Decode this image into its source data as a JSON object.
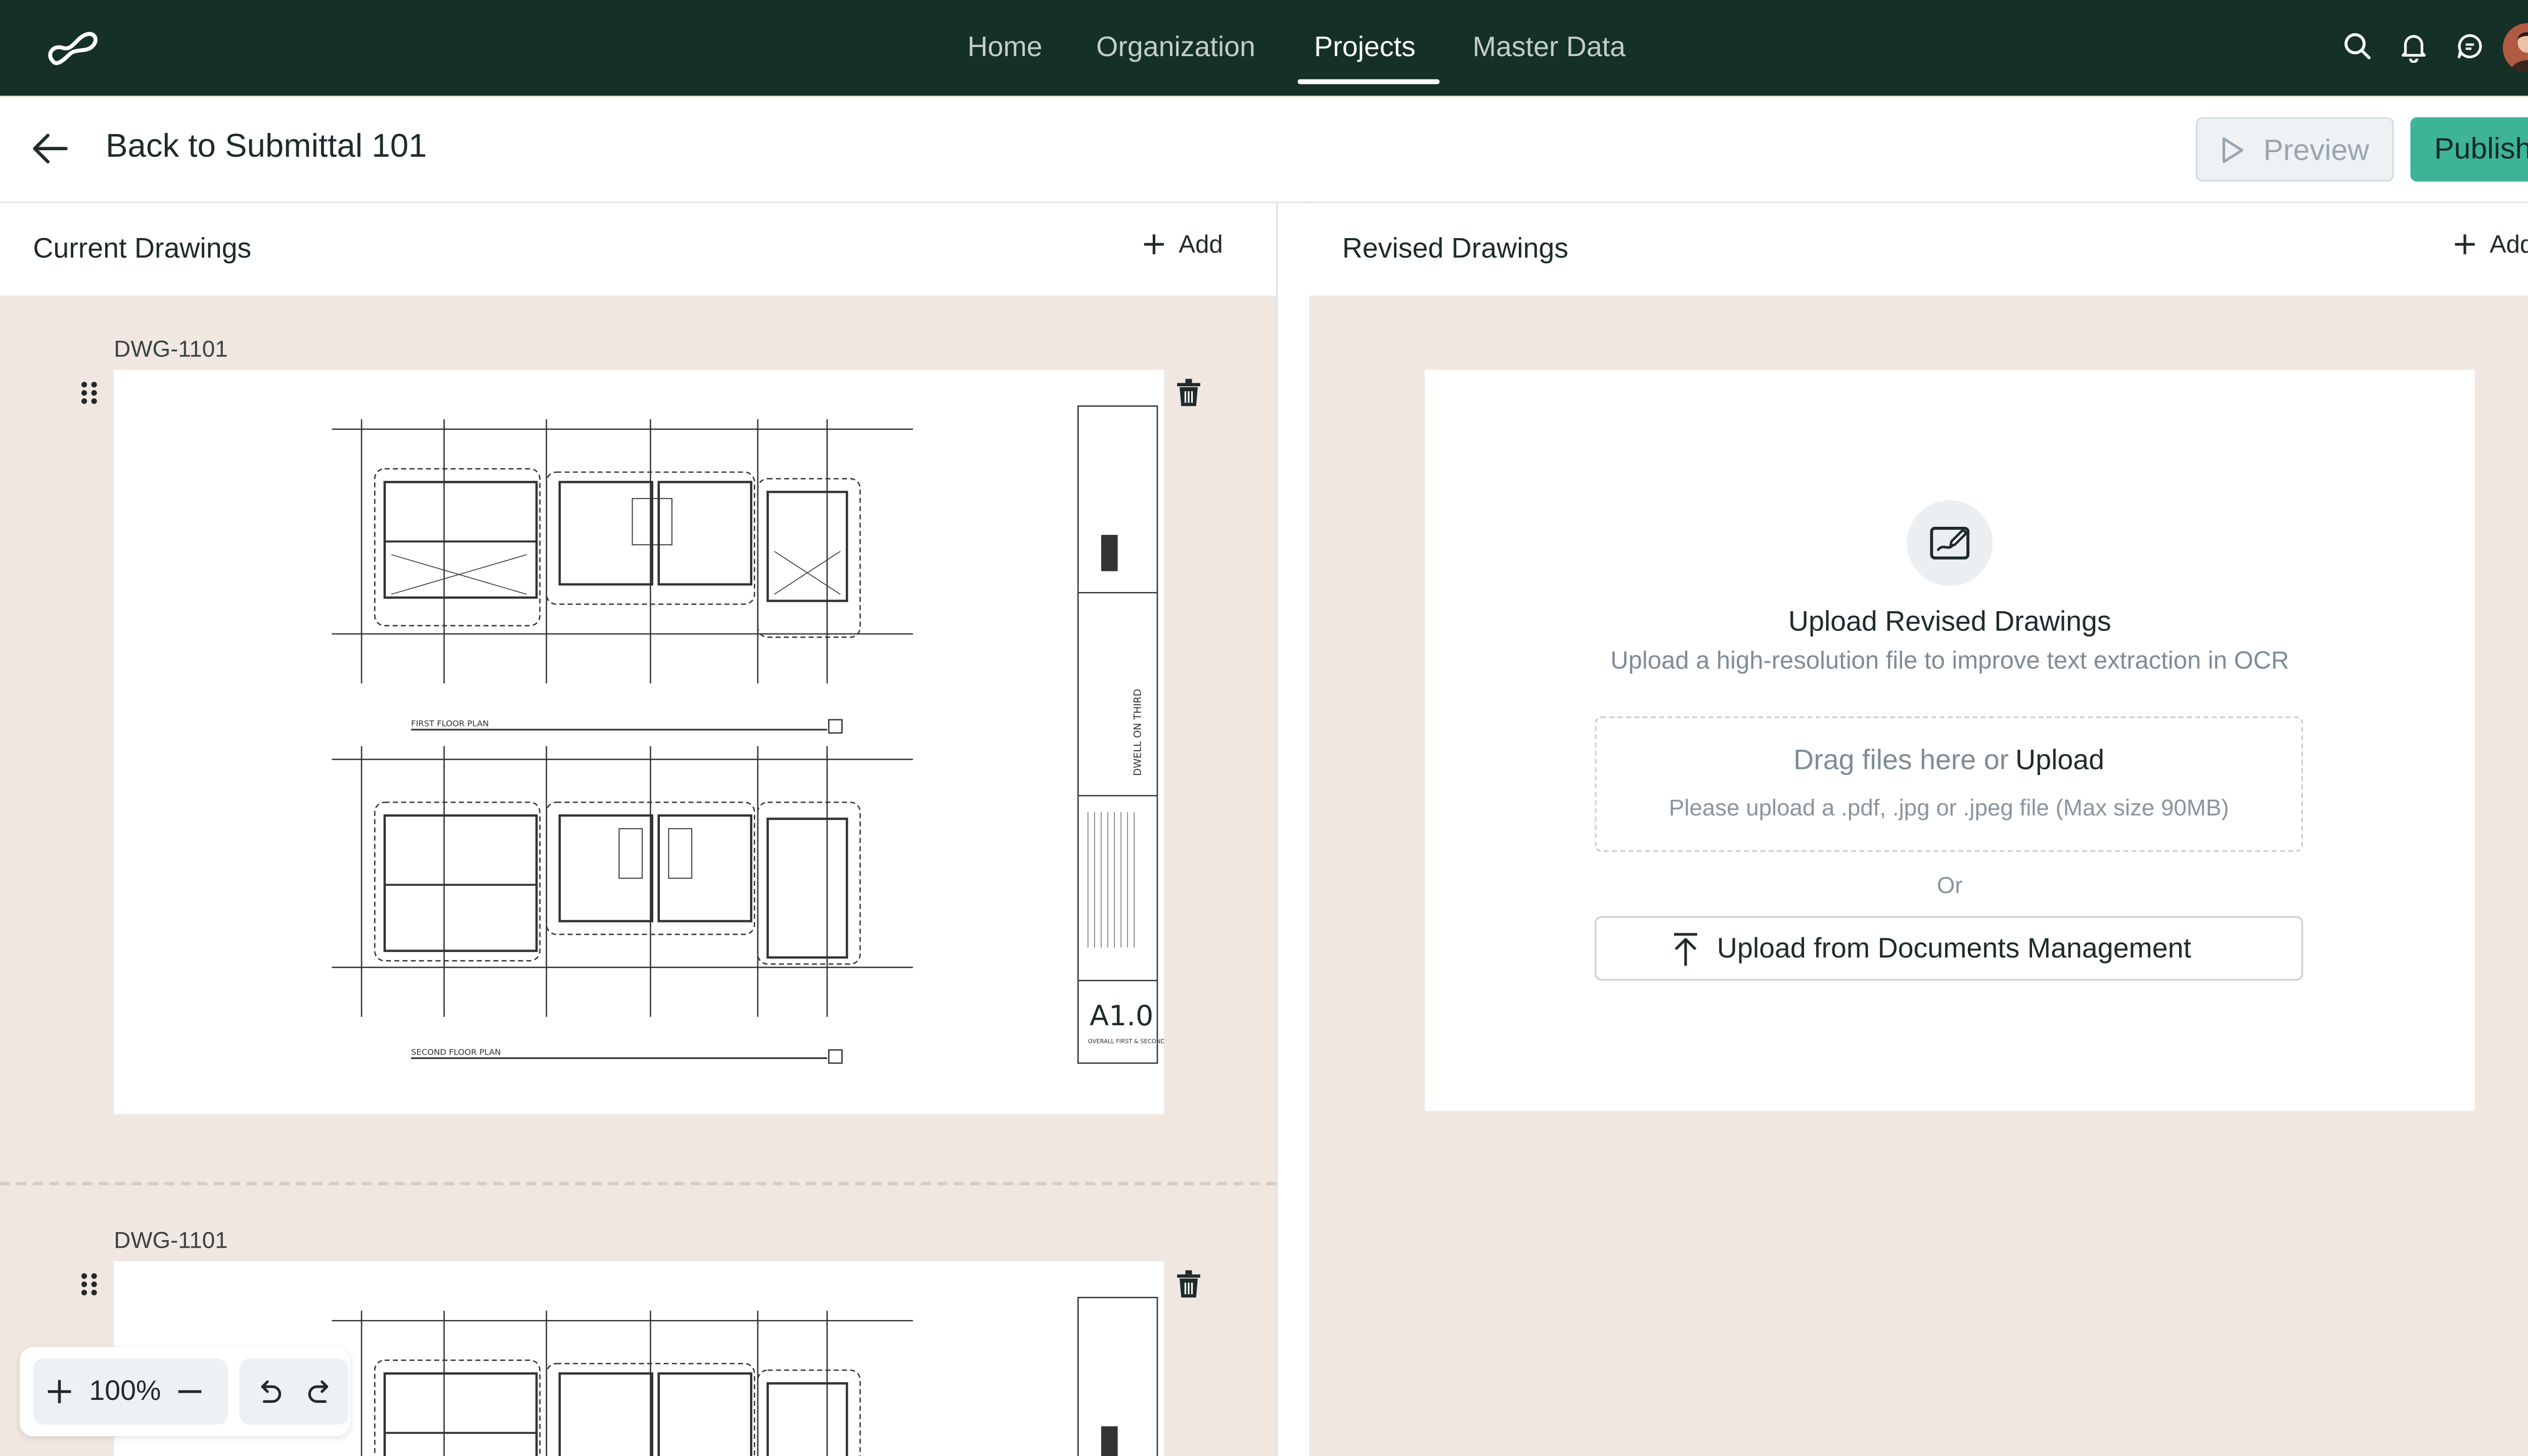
{
  "nav": {
    "items": [
      {
        "label": "Home",
        "active": false
      },
      {
        "label": "Organization",
        "active": false
      },
      {
        "label": "Projects",
        "active": true
      },
      {
        "label": "Master Data",
        "active": false
      }
    ],
    "icons": [
      "search-icon",
      "bell-icon",
      "chat-icon"
    ]
  },
  "header": {
    "back_label": "Back to Submittal 101",
    "preview_label": "Preview",
    "publish_label": "Publish"
  },
  "current": {
    "title": "Current Drawings",
    "add_label": "Add",
    "drawings": [
      {
        "id": "DWG-1101",
        "sheet_number": "A1.0",
        "project": "DWELL ON THIRD",
        "plan_labels": [
          "FIRST FLOOR PLAN",
          "SECOND FLOOR PLAN"
        ],
        "sheet_title": "OVERALL FIRST & SECOND FLOOR PLANS"
      },
      {
        "id": "DWG-1101"
      }
    ]
  },
  "revised": {
    "title": "Revised Drawings",
    "add_label": "Add",
    "upload": {
      "title": "Upload Revised Drawings",
      "subtitle": "Upload a high-resolution file to improve text extraction in OCR",
      "drag_text": "Drag files here or",
      "upload_link": "Upload",
      "hint": "Please upload a .pdf, .jpg or .jpeg file (Max size 90MB)",
      "or": "Or",
      "docs_button": "Upload from Documents Management"
    }
  },
  "zoom": {
    "value": "100%"
  },
  "colors": {
    "topbar": "#143027",
    "accent": "#3db497",
    "canvas": "#f0e8e0"
  }
}
